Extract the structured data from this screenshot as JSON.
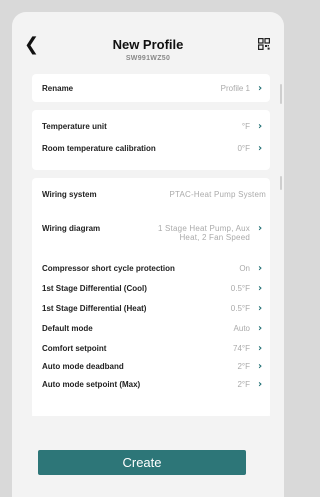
{
  "header": {
    "title": "New Profile",
    "subtitle": "SW991WZ50",
    "back_icon": "chevron-left-icon",
    "qr_icon": "qr-code-icon"
  },
  "rename": {
    "label": "Rename",
    "value": "Profile 1"
  },
  "temperature": {
    "unit_label": "Temperature unit",
    "unit_value": "°F",
    "calibration_label": "Room temperature calibration",
    "calibration_value": "0°F"
  },
  "settings": [
    {
      "label": "Wiring system",
      "value": "PTAC-Heat Pump System"
    },
    {
      "label": "Wiring diagram",
      "value": "1 Stage Heat Pump, Aux Heat, 2 Fan Speed"
    },
    {
      "label": "Compressor short cycle protection",
      "value": "On"
    },
    {
      "label": "1st Stage Differential (Cool)",
      "value": "0.5°F"
    },
    {
      "label": "1st Stage Differential (Heat)",
      "value": "0.5°F"
    },
    {
      "label": "Default mode",
      "value": "Auto"
    },
    {
      "label": "Comfort setpoint",
      "value": "74°F"
    },
    {
      "label": "Auto mode deadband",
      "value": "2°F"
    },
    {
      "label": "Auto mode setpoint (Max)",
      "value": "2°F"
    }
  ],
  "create_label": "Create",
  "colors": {
    "accent": "#2d7678",
    "chevron": "#1f6f74",
    "background": "#f3f3f3"
  }
}
